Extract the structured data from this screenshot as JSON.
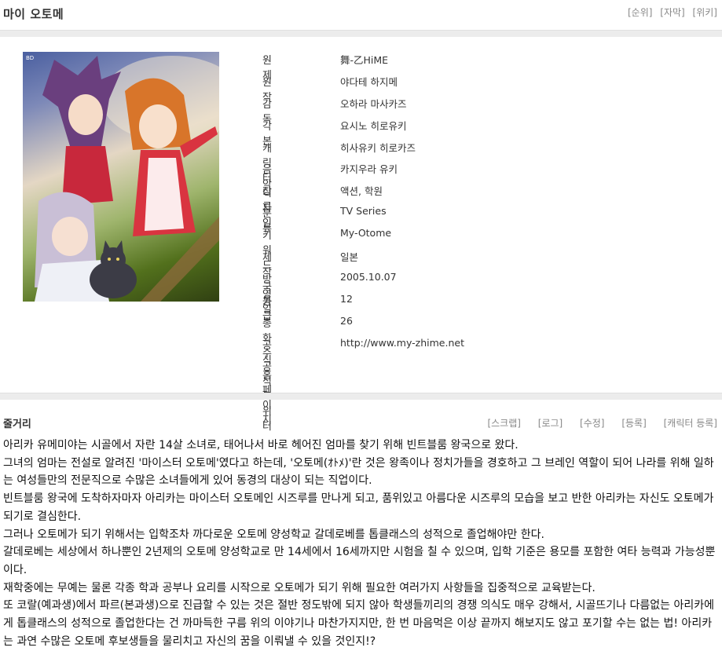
{
  "header": {
    "title": "마이 오토메",
    "links": [
      "[순위]",
      "[자막]",
      "[위키]"
    ]
  },
  "poster": {
    "alt": "마이 오토메 포스터",
    "corner_mark": "BD"
  },
  "info": [
    {
      "label": "원제",
      "value": "舞-乙HiME"
    },
    {
      "label": "원작",
      "value": "야다테 하지메"
    },
    {
      "label": "감독",
      "value": "오하라 마사카즈"
    },
    {
      "label": "각본",
      "value": "요시노 히로유키"
    },
    {
      "label": "캐릭터 디자인",
      "value": "히사유키 히로카즈"
    },
    {
      "label": "음악",
      "value": "카지우라 유키"
    },
    {
      "label": "장르",
      "value": "액션, 학원"
    },
    {
      "label": "분류",
      "value": "TV Series"
    },
    {
      "label": "키워드",
      "value": "My-Otome"
    },
    {
      "label": "제작국가",
      "value": "일본"
    },
    {
      "label": "방영일",
      "value": "2005.10.07"
    },
    {
      "label": "등급",
      "value": "12"
    },
    {
      "label": "총화수",
      "value": "26"
    },
    {
      "label": "공식홈페이지",
      "value": "http://www.my-zhime.net"
    },
    {
      "label": "공식트위터",
      "value": ""
    }
  ],
  "synopsis": {
    "heading": "줄거리",
    "links": [
      "[스크랩]",
      "[로그]",
      "[수정]",
      "[등록]",
      "[캐릭터 등록]"
    ],
    "paragraphs": [
      "아리카 유메미야는 시골에서 자란 14살 소녀로, 태어나서 바로 헤어진 엄마를 찾기 위해 빈트블룸 왕국으로 왔다.",
      " 그녀의 엄마는 전설로 알려진 '마이스터 오토메'였다고 하는데, '오토메(ｵﾄﾒ)'란 것은 왕족이나 정치가들을 경호하고 그 브레인 역할이 되어 나라를 위해 일하는 여성들만의 전문직으로 수많은 소녀들에게 있어 동경의 대상이 되는 직업이다.",
      " 빈트블룸 왕국에 도착하자마자 아리카는 마이스터 오토메인 시즈루를 만나게 되고, 품위있고 아름다운 시즈루의 모습을 보고 반한 아리카는 자신도 오토메가 되기로 결심한다.",
      " 그러나 오토메가 되기 위해서는 입학조차 까다로운 오토메 양성학교 갈데로베를 톱클래스의 성적으로 졸업해야만 한다.",
      " 갈데로베는 세상에서 하나뿐인 2년제의 오토메 양성학교로 만 14세에서 16세까지만 시험을 칠 수 있으며, 입학 기준은 용모를 포함한 여타 능력과 가능성뿐이다.",
      " 재학중에는 무예는 물론 각종 학과 공부나 요리를 시작으로 오토메가 되기 위해 필요한 여러가지 사항들을 집중적으로 교육받는다.",
      " 또 코랄(예과생)에서 파르(본과생)으로 진급할 수 있는 것은 절반 정도밖에 되지 않아 학생들끼리의 경쟁 의식도 매우 강해서, 시골뜨기나 다름없는 아리카에게 톱클래스의 성적으로 졸업한다는 건 까마득한 구름 위의 이야기나 마찬가지지만, 한 번 마음먹은 이상 끝까지 해보지도 않고 포기할 수는 없는 법! 아리카는 과연 수많은 오토메 후보생들을 물리치고 자신의 꿈을 이뤄낼 수 있을 것인지!?"
    ]
  }
}
